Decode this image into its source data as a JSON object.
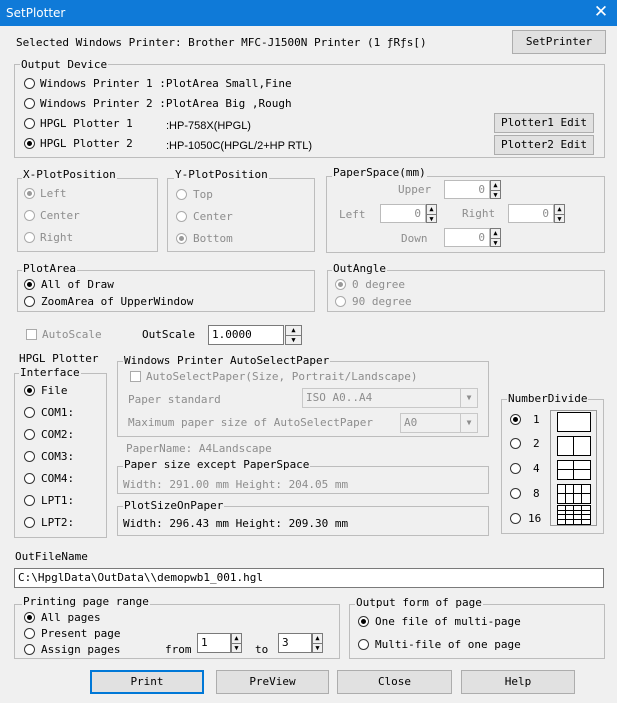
{
  "window": {
    "title": "SetPlotter",
    "close_glyph": "✕"
  },
  "selected_printer": {
    "label": "Selected Windows Printer: Brother MFC-J1500N Printer (1 ƒRƒs[)",
    "button": "SetPrinter"
  },
  "output_device": {
    "legend": "Output Device",
    "items": [
      {
        "label": "Windows Printer 1 :PlotArea Small,Fine",
        "detail": "",
        "selected": false
      },
      {
        "label": "Windows Printer 2 :PlotArea Big  ,Rough",
        "detail": "",
        "selected": false
      },
      {
        "label": "HPGL Plotter 1",
        "detail": ":HP-758X(HPGL)",
        "selected": false
      },
      {
        "label": "HPGL Plotter 2",
        "detail": ":HP-1050C(HPGL/2+HP RTL)",
        "selected": true
      }
    ],
    "plotter1_edit": "Plotter1 Edit",
    "plotter2_edit": "Plotter2 Edit"
  },
  "x_plot_position": {
    "legend": "X-PlotPosition",
    "options": [
      "Left",
      "Center",
      "Right"
    ],
    "selected": "Left"
  },
  "y_plot_position": {
    "legend": "Y-PlotPosition",
    "options": [
      "Top",
      "Center",
      "Bottom"
    ],
    "selected": "Bottom"
  },
  "paper_space": {
    "legend": "PaperSpace(mm)",
    "upper_label": "Upper",
    "left_label": "Left",
    "right_label": "Right",
    "down_label": "Down",
    "upper": "0",
    "left": "0",
    "right": "0",
    "down": "0"
  },
  "plot_area": {
    "legend": "PlotArea",
    "options": [
      "All of Draw",
      "ZoomArea of UpperWindow"
    ],
    "selected": "All of Draw"
  },
  "out_angle": {
    "legend": "OutAngle",
    "options": [
      "0 degree",
      "90 degree"
    ],
    "selected": "0 degree"
  },
  "auto_scale": {
    "label": "AutoScale",
    "checked": false
  },
  "out_scale": {
    "label": "OutScale",
    "value": "1.0000"
  },
  "hpgl_interface": {
    "legend_line1": "HPGL Plotter",
    "legend_line2": "Interface",
    "options": [
      "File",
      "COM1:",
      "COM2:",
      "COM3:",
      "COM4:",
      "LPT1:",
      "LPT2:"
    ],
    "selected": "File"
  },
  "auto_select_paper": {
    "legend": "Windows Printer AutoSelectPaper",
    "checkbox_label": "AutoSelectPaper(Size, Portrait/Landscape)",
    "paper_standard_label": "Paper standard",
    "paper_standard_value": "ISO A0..A4",
    "max_paper_label": "Maximum paper size of AutoSelectPaper",
    "max_paper_value": "A0",
    "paper_name": "PaperName:  A4Landscape"
  },
  "paper_size_except": {
    "legend": "Paper size except PaperSpace",
    "text": "Width: 291.00 mm    Height: 204.05 mm"
  },
  "plot_size_on_paper": {
    "legend": "PlotSizeOnPaper",
    "text": "Width: 296.43 mm    Height: 209.30 mm"
  },
  "number_divide": {
    "legend": "NumberDivide",
    "options": [
      "1",
      "2",
      "4",
      "8",
      "16"
    ],
    "selected": "1"
  },
  "out_file": {
    "label": "OutFileName",
    "value": "C:\\HpglData\\OutData\\\\demopwb1_001.hgl"
  },
  "page_range": {
    "legend": "Printing page range",
    "options": [
      "All pages",
      "Present page",
      "Assign pages"
    ],
    "selected": "All pages",
    "from_label": "from",
    "from_value": "1",
    "to_label": "to",
    "to_value": "3"
  },
  "output_form": {
    "legend": "Output form of page",
    "options": [
      "One file of multi-page",
      "Multi-file of one page"
    ],
    "selected": "One file of multi-page"
  },
  "buttons": {
    "print": "Print",
    "preview": "PreView",
    "close": "Close",
    "help": "Help"
  }
}
